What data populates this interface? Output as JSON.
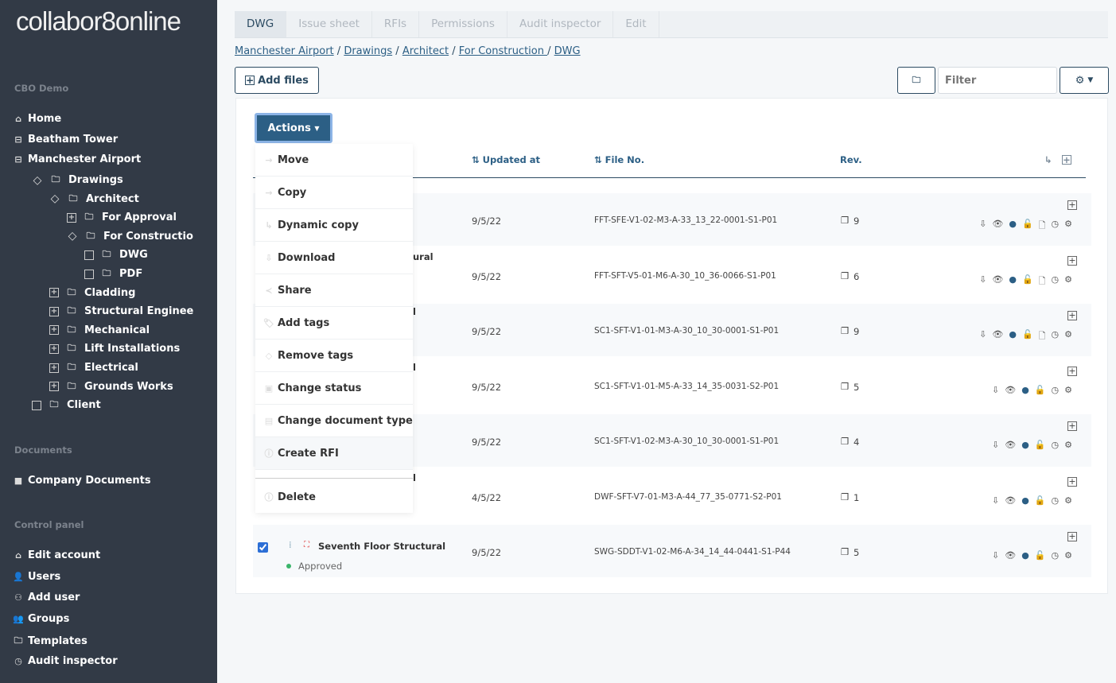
{
  "sidebar": {
    "logo": "collabor8online",
    "org": "CBO Demo",
    "nav": [
      {
        "label": "Home",
        "icon": "home-icon"
      },
      {
        "label": "Beatham Tower",
        "icon": "briefcase-icon"
      },
      {
        "label": "Manchester Airport",
        "icon": "briefcase-icon"
      }
    ],
    "tree": [
      {
        "label": "Drawings",
        "level": 1,
        "toggle": "collapse"
      },
      {
        "label": "Architect",
        "level": 2,
        "toggle": "collapse"
      },
      {
        "label": "For Approval",
        "level": 3,
        "toggle": "expand"
      },
      {
        "label": "For Constructio",
        "level": 3,
        "toggle": "collapse"
      },
      {
        "label": "DWG",
        "level": 4,
        "toggle": "none"
      },
      {
        "label": "PDF",
        "level": 4,
        "toggle": "none"
      },
      {
        "label": "Cladding",
        "level": 2,
        "toggle": "expand"
      },
      {
        "label": "Structural Enginee",
        "level": 2,
        "toggle": "expand"
      },
      {
        "label": "Mechanical",
        "level": 2,
        "toggle": "expand"
      },
      {
        "label": "Lift Installations",
        "level": 2,
        "toggle": "expand"
      },
      {
        "label": "Electrical",
        "level": 2,
        "toggle": "expand"
      },
      {
        "label": "Grounds Works",
        "level": 2,
        "toggle": "expand"
      },
      {
        "label": "Client",
        "level": 1,
        "toggle": "none"
      }
    ],
    "documents_heading": "Documents",
    "company_documents": "Company Documents",
    "control_heading": "Control panel",
    "control": [
      {
        "label": "Edit account",
        "icon": "⌂"
      },
      {
        "label": "Users",
        "icon": "👤"
      },
      {
        "label": "Add user",
        "icon": "⚇"
      },
      {
        "label": "Groups",
        "icon": "👥"
      },
      {
        "label": "Templates",
        "icon": "🗀"
      },
      {
        "label": "Audit inspector",
        "icon": "◷"
      }
    ]
  },
  "tabs": [
    "DWG",
    "Issue sheet",
    "RFIs",
    "Permissions",
    "Audit inspector",
    "Edit"
  ],
  "active_tab": "DWG",
  "breadcrumb": [
    "Manchester Airport",
    "Drawings",
    "Architect",
    "For Construction ",
    "DWG"
  ],
  "toolbar": {
    "add_files": "Add files",
    "filter_placeholder": "Filter"
  },
  "actions": {
    "label": "Actions",
    "items": [
      {
        "label": "Move",
        "icon": "→"
      },
      {
        "label": "Copy",
        "icon": "→"
      },
      {
        "label": "Dynamic copy",
        "icon": "↳"
      },
      {
        "label": "Download",
        "icon": "⇩"
      },
      {
        "label": "Share",
        "icon": "≺"
      },
      {
        "label": "Add tags",
        "icon": "🏷"
      },
      {
        "label": "Remove tags",
        "icon": "◇"
      },
      {
        "label": "Change status",
        "icon": "▣"
      },
      {
        "label": "Change document type",
        "icon": "▤"
      },
      {
        "label": "Create RFI",
        "icon": "ⓘ"
      }
    ],
    "delete": {
      "label": "Delete",
      "icon": "ⓘ"
    }
  },
  "columns": {
    "updated": "Updated at",
    "file_no": "File No.",
    "rev": "Rev."
  },
  "rows": [
    {
      "name": "",
      "updated": "9/5/22",
      "file_no": "FFT-SFE-V1-02-M3-A-33_13_22-0001-S1-P01",
      "rev": "9",
      "file_icon": true
    },
    {
      "name": "ural",
      "updated": "9/5/22",
      "file_no": "FFT-SFT-V5-01-M6-A-30_10_36-0066-S1-P01",
      "rev": "6",
      "file_icon": true
    },
    {
      "name": "l",
      "updated": "9/5/22",
      "file_no": "SC1-SFT-V1-01-M3-A-30_10_30-0001-S1-P01",
      "rev": "9",
      "file_icon": true
    },
    {
      "name": "l",
      "updated": "9/5/22",
      "file_no": "SC1-SFT-V1-01-M5-A-33_14_35-0031-S2-P01",
      "rev": "5",
      "file_icon": false
    },
    {
      "name": "",
      "updated": "9/5/22",
      "file_no": "SC1-SFT-V1-02-M3-A-30_10_30-0001-S1-P01",
      "rev": "4",
      "file_icon": false
    },
    {
      "name": "l",
      "updated": "4/5/22",
      "file_no": "DWF-SFT-V7-01-M3-A-44_77_35-0771-S2-P01",
      "rev": "1",
      "file_icon": false
    },
    {
      "name": "Seventh Floor Structural",
      "status": "Approved",
      "checked": true,
      "updated": "9/5/22",
      "file_no": "SWG-SDDT-V1-02-M6-A-34_14_44-0441-S1-P44",
      "rev": "5",
      "file_icon": false
    }
  ],
  "colors": {
    "sidebar": "#323a46",
    "accent": "#2c5f85",
    "approved": "#3bb56a"
  }
}
